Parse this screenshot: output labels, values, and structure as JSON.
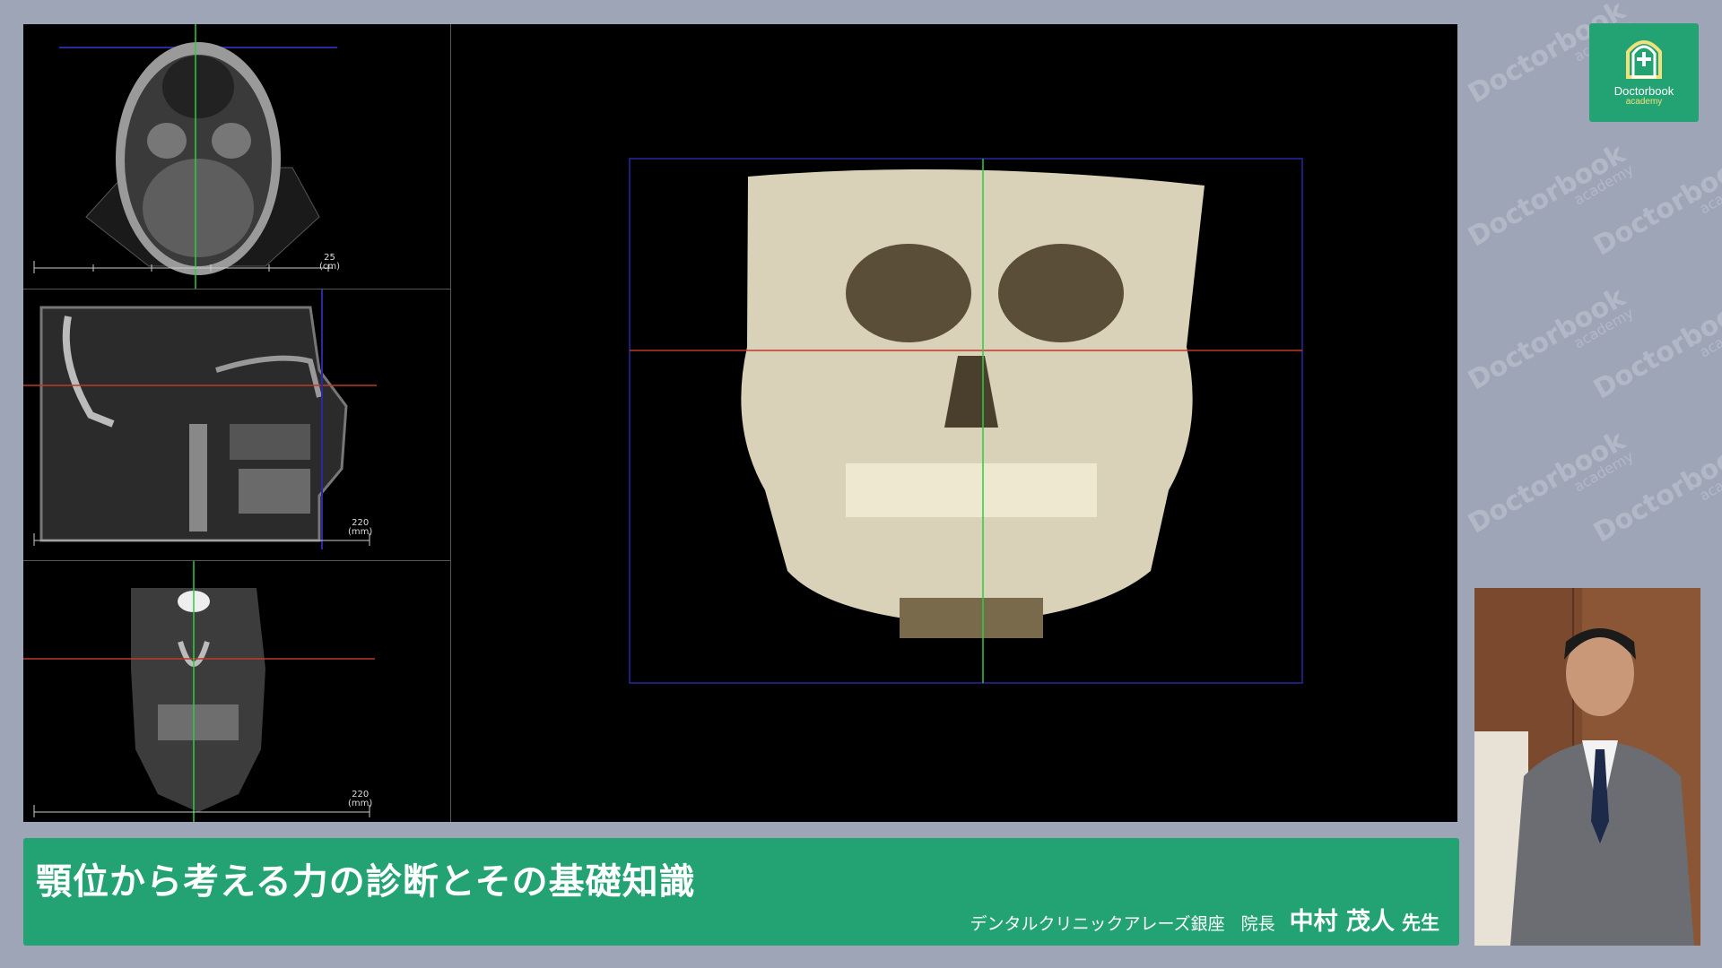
{
  "lecture": {
    "title": "顎位から考える力の診断とその基礎知識",
    "clinic": "デンタルクリニックアレーズ銀座",
    "role": "院長",
    "presenter_name": "中村 茂人",
    "honorific": "先生"
  },
  "brand": {
    "logo_name": "Doctorbook",
    "logo_sub": "academy",
    "watermark_name": "Doctorbook",
    "watermark_sub": "academy",
    "color": "#23a373"
  },
  "viewer": {
    "axial_scale_label": "25",
    "axial_scale_unit": "(cm)",
    "sagittal_scale_label": "220",
    "sagittal_scale_unit": "(mm)",
    "coronal_scale_label": "220",
    "coronal_scale_unit": "(mm)"
  },
  "icons": {
    "logo": "shield-plus-icon"
  }
}
